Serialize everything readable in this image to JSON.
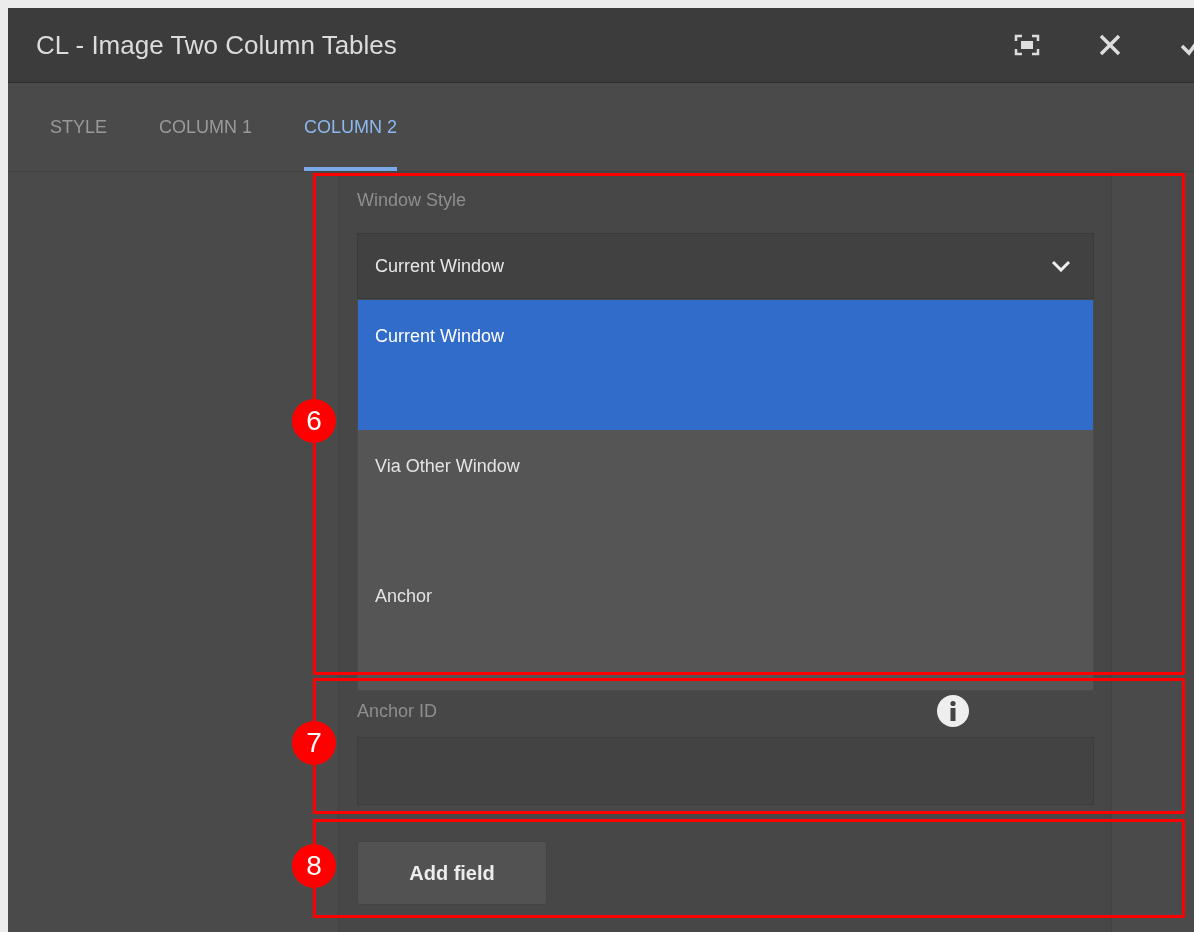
{
  "dialog": {
    "title": "CL - Image Two Column Tables"
  },
  "tabs": [
    {
      "label": "STYLE",
      "selected": false
    },
    {
      "label": "COLUMN 1",
      "selected": false
    },
    {
      "label": "COLUMN 2",
      "selected": true
    }
  ],
  "window_style": {
    "label": "Window Style",
    "value": "Current Window",
    "expanded": true,
    "options": [
      {
        "label": "Current Window",
        "selected": true
      },
      {
        "label": "Via Other Window",
        "selected": false
      },
      {
        "label": "Anchor",
        "selected": false
      }
    ]
  },
  "anchor_id": {
    "label": "Anchor ID"
  },
  "add_button": "Add field",
  "callouts": [
    {
      "number": "6"
    },
    {
      "number": "7"
    },
    {
      "number": "8"
    }
  ]
}
